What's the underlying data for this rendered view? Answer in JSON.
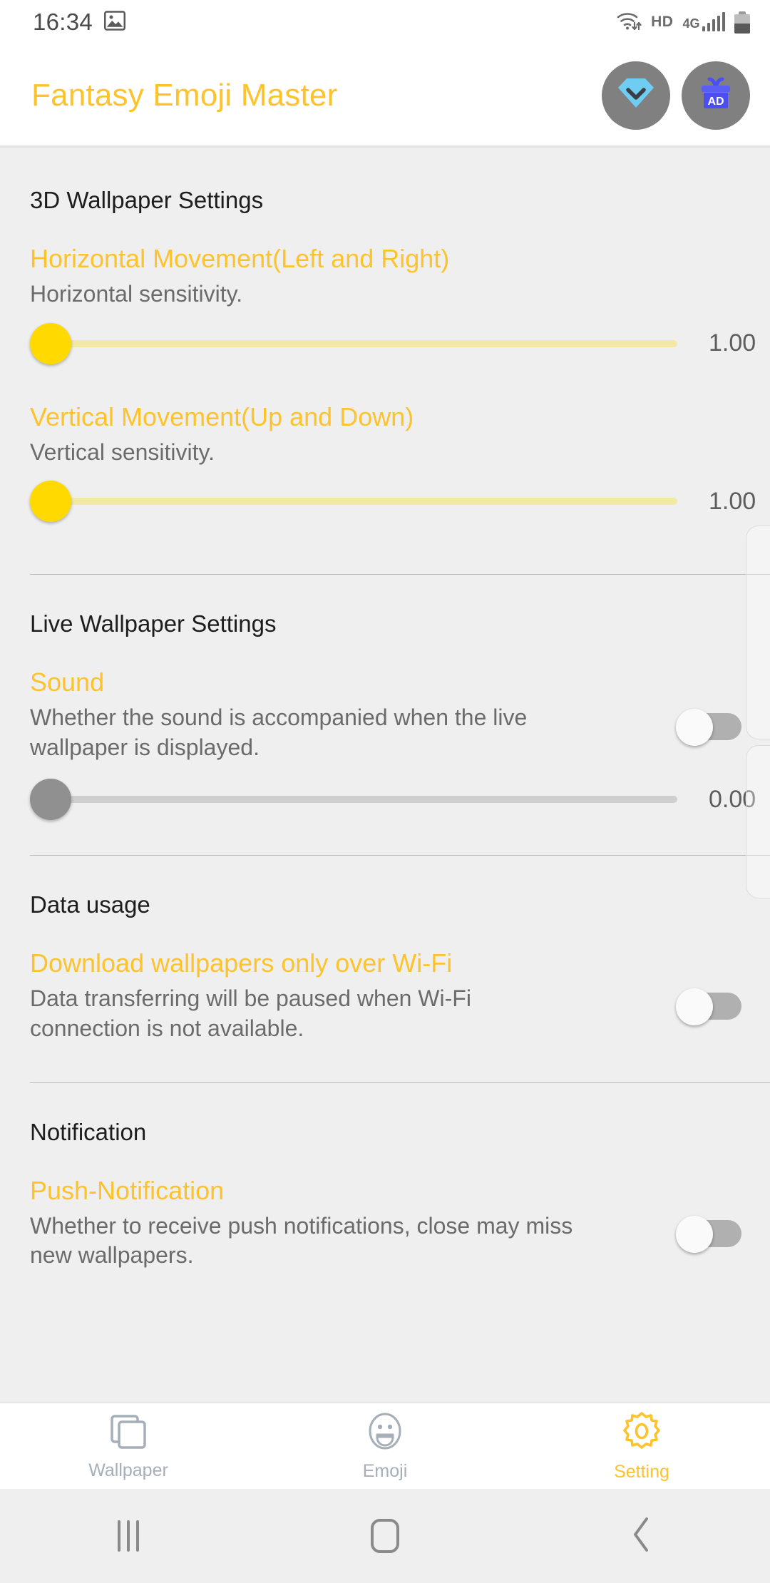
{
  "statusbar": {
    "time": "16:34",
    "image_icon": "image-icon",
    "wifi_icon": "wifi-data-icon",
    "hd_label": "HD",
    "network_label": "4G",
    "signal_icon": "signal-bars-icon",
    "battery_icon": "battery-icon"
  },
  "appbar": {
    "title": "Fantasy Emoji Master",
    "actions": [
      {
        "name": "vip-diamond-button",
        "icon": "diamond-chevron-icon",
        "color": "#6fcdf2"
      },
      {
        "name": "ad-gift-button",
        "icon": "gift-box-ad-icon",
        "label": "AD",
        "color": "#4b4ef0"
      }
    ]
  },
  "colors": {
    "accent": "#fcc32c",
    "page_background": "#efefef",
    "surface": "#ffffff",
    "title_text": "#1d1d1d",
    "summary_text": "#6b6b6b",
    "slider_yellow_thumb": "#ffd900",
    "slider_yellow_track": "#f2eaa4",
    "slider_grey_thumb": "#909090",
    "slider_grey_track": "#cfcfcf",
    "switch_off_track": "#b0b0b0",
    "tab_inactive": "#a6aeb8"
  },
  "sections": [
    {
      "name": "3d-wallpaper-settings",
      "heading": "3D Wallpaper Settings",
      "items": [
        {
          "name": "horizontal-movement",
          "title": "Horizontal Movement(Left and Right)",
          "summary": "Horizontal sensitivity.",
          "control": "slider",
          "value": "1.00",
          "fraction": 0.0,
          "style": "yellow"
        },
        {
          "name": "vertical-movement",
          "title": "Vertical Movement(Up and Down)",
          "summary": "Vertical sensitivity.",
          "control": "slider",
          "value": "1.00",
          "fraction": 0.0,
          "style": "yellow"
        }
      ]
    },
    {
      "name": "live-wallpaper-settings",
      "heading": "Live Wallpaper Settings",
      "items": [
        {
          "name": "sound",
          "title": "Sound",
          "summary": "Whether the sound is accompanied when the live wallpaper is displayed.",
          "control": "switch+slider",
          "switch_on": false,
          "value": "0.00",
          "fraction": 0.0,
          "style": "grey"
        }
      ]
    },
    {
      "name": "data-usage",
      "heading": "Data usage",
      "items": [
        {
          "name": "download-over-wifi-only",
          "title": "Download wallpapers only over Wi-Fi",
          "summary": "Data transferring will be paused when Wi-Fi connection is not available.",
          "control": "switch",
          "switch_on": false
        }
      ]
    },
    {
      "name": "notification",
      "heading": "Notification",
      "items": [
        {
          "name": "push-notification",
          "title": "Push-Notification",
          "summary": "Whether to receive push notifications, close may miss new wallpapers.",
          "control": "switch",
          "switch_on": false
        }
      ]
    }
  ],
  "tabbar": {
    "tabs": [
      {
        "name": "tab-wallpaper",
        "label": "Wallpaper",
        "icon": "wallpaper-stack-icon",
        "active": false
      },
      {
        "name": "tab-emoji",
        "label": "Emoji",
        "icon": "smiley-face-icon",
        "active": false
      },
      {
        "name": "tab-setting",
        "label": "Setting",
        "icon": "gear-icon",
        "active": true
      }
    ]
  },
  "navbar": {
    "recents_icon": "recents-icon",
    "home_icon": "home-icon",
    "back_icon": "back-chevron-icon"
  }
}
